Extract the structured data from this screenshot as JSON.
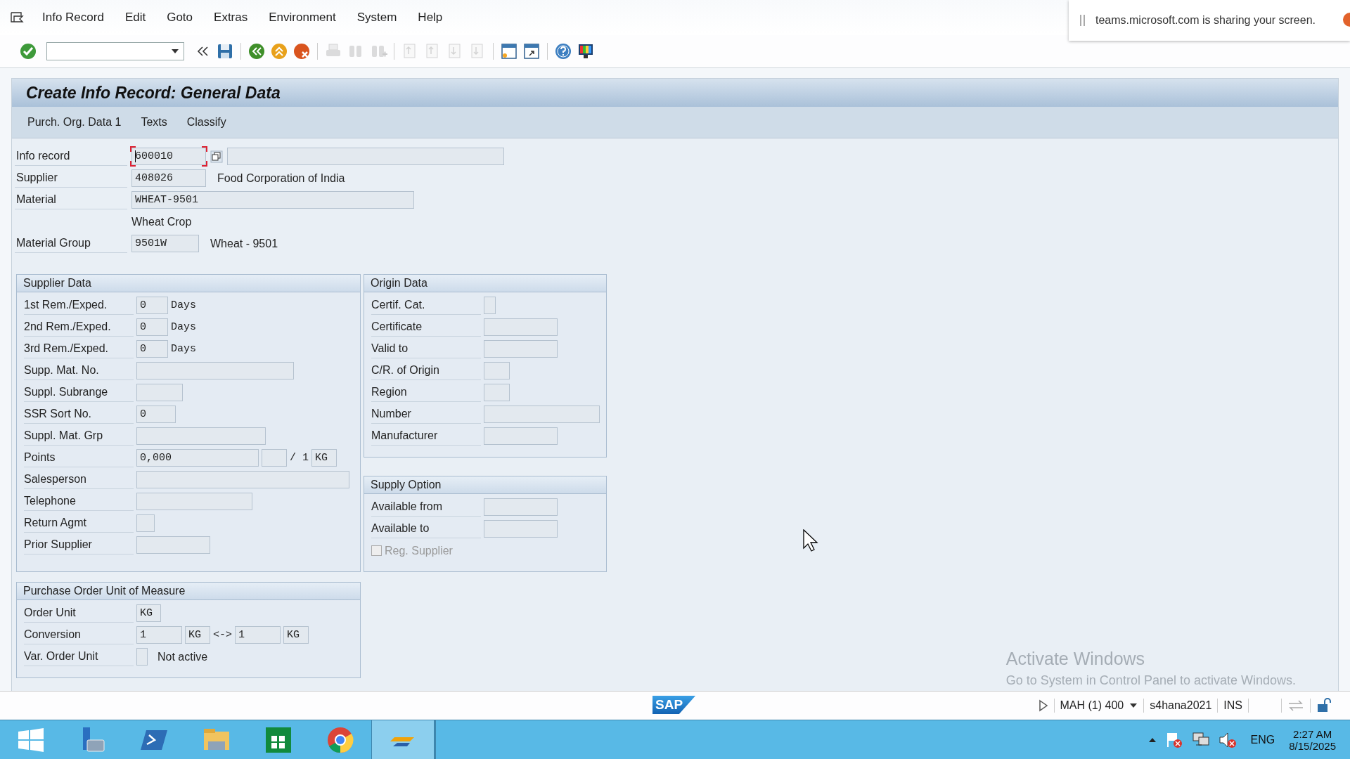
{
  "menu": [
    {
      "label": "Info Record"
    },
    {
      "label": "Edit"
    },
    {
      "label": "Goto"
    },
    {
      "label": "Extras"
    },
    {
      "label": "Environment"
    },
    {
      "label": "System"
    },
    {
      "label": "Help"
    }
  ],
  "toolbar": [
    {
      "kind": "enter",
      "disabled": false
    },
    {
      "kind": "command-field"
    },
    {
      "kind": "collapse",
      "disabled": false
    },
    {
      "kind": "save",
      "disabled": false
    },
    {
      "kind": "sep"
    },
    {
      "kind": "back",
      "disabled": false
    },
    {
      "kind": "exit",
      "disabled": false
    },
    {
      "kind": "cancel",
      "disabled": false
    },
    {
      "kind": "sep"
    },
    {
      "kind": "print",
      "disabled": true
    },
    {
      "kind": "find",
      "disabled": true
    },
    {
      "kind": "find-next",
      "disabled": true
    },
    {
      "kind": "sep"
    },
    {
      "kind": "first-page",
      "disabled": true
    },
    {
      "kind": "prev-page",
      "disabled": true
    },
    {
      "kind": "next-page",
      "disabled": true
    },
    {
      "kind": "last-page",
      "disabled": true
    },
    {
      "kind": "sep"
    },
    {
      "kind": "new-session",
      "disabled": false
    },
    {
      "kind": "shortcut",
      "disabled": false
    },
    {
      "kind": "sep"
    },
    {
      "kind": "help",
      "disabled": false
    },
    {
      "kind": "layout",
      "disabled": false
    }
  ],
  "notification": {
    "text": "teams.microsoft.com is sharing your screen."
  },
  "title": "Create Info Record: General Data",
  "app_toolbar": [
    {
      "label": "Purch. Org. Data 1"
    },
    {
      "label": "Texts"
    },
    {
      "label": "Classify"
    }
  ],
  "header": [
    {
      "label": "Info record",
      "parts": [
        {
          "kind": "field",
          "value": "600010",
          "focused": true
        },
        {
          "kind": "button"
        },
        {
          "kind": "field"
        }
      ]
    },
    {
      "label": "Supplier",
      "parts": [
        {
          "kind": "field",
          "value": "408026"
        },
        {
          "kind": "text",
          "value": "Food Corporation of India"
        }
      ]
    },
    {
      "label": "Material",
      "parts": [
        {
          "kind": "field",
          "value": "WHEAT-9501"
        }
      ]
    },
    {
      "parts": [
        {
          "kind": "text",
          "value": "Wheat Crop"
        }
      ]
    },
    {
      "label": "Material Group",
      "parts": [
        {
          "kind": "field",
          "value": "9501W"
        },
        {
          "kind": "text",
          "value": "Wheat - 9501"
        }
      ]
    }
  ],
  "groups": [
    {
      "title": "Supplier Data",
      "rows": [
        {
          "label": "1st Rem./Exped.",
          "parts": [
            {
              "kind": "field",
              "value": "0"
            },
            {
              "kind": "unit",
              "value": "Days"
            }
          ]
        },
        {
          "label": "2nd Rem./Exped.",
          "parts": [
            {
              "kind": "field",
              "value": "0"
            },
            {
              "kind": "unit",
              "value": "Days"
            }
          ]
        },
        {
          "label": "3rd Rem./Exped.",
          "parts": [
            {
              "kind": "field",
              "value": "0"
            },
            {
              "kind": "unit",
              "value": "Days"
            }
          ]
        },
        {
          "label": "Supp. Mat. No.",
          "parts": [
            {
              "kind": "field"
            }
          ]
        },
        {
          "label": "Suppl. Subrange",
          "parts": [
            {
              "kind": "field"
            }
          ]
        },
        {
          "label": "SSR Sort No.",
          "parts": [
            {
              "kind": "field",
              "value": "0"
            }
          ]
        },
        {
          "label": "Suppl. Mat. Grp",
          "parts": [
            {
              "kind": "field"
            }
          ]
        },
        {
          "label": "Points",
          "parts": [
            {
              "kind": "field",
              "value": "0,000"
            },
            {
              "kind": "field"
            },
            {
              "kind": "unit",
              "value": "/ 1"
            },
            {
              "kind": "field",
              "value": "KG"
            }
          ]
        },
        {
          "label": "Salesperson",
          "parts": [
            {
              "kind": "field"
            }
          ]
        },
        {
          "label": "Telephone",
          "parts": [
            {
              "kind": "field"
            }
          ]
        },
        {
          "label": "Return Agmt",
          "parts": [
            {
              "kind": "field"
            }
          ]
        },
        {
          "label": "Prior Supplier",
          "parts": [
            {
              "kind": "field"
            }
          ]
        }
      ]
    },
    {
      "title": "Origin Data",
      "rows": [
        {
          "label": "Certif. Cat.",
          "parts": [
            {
              "kind": "field"
            }
          ]
        },
        {
          "label": "Certificate",
          "parts": [
            {
              "kind": "field"
            }
          ]
        },
        {
          "label": "Valid to",
          "parts": [
            {
              "kind": "field"
            }
          ]
        },
        {
          "label": "C/R. of Origin",
          "parts": [
            {
              "kind": "field"
            }
          ]
        },
        {
          "label": "Region",
          "parts": [
            {
              "kind": "field"
            }
          ]
        },
        {
          "label": "Number",
          "parts": [
            {
              "kind": "field"
            }
          ]
        },
        {
          "label": "Manufacturer",
          "parts": [
            {
              "kind": "field"
            }
          ]
        }
      ]
    },
    {
      "title": "Supply Option",
      "rows": [
        {
          "label": "Available from",
          "parts": [
            {
              "kind": "field"
            }
          ]
        },
        {
          "label": "Available to",
          "parts": [
            {
              "kind": "field"
            }
          ]
        },
        {
          "parts": [
            {
              "kind": "checkbox",
              "value": "Reg. Supplier",
              "checked": false,
              "disabled": true
            }
          ]
        }
      ]
    },
    {
      "title": "Purchase Order Unit of Measure",
      "rows": [
        {
          "label": "Order Unit",
          "parts": [
            {
              "kind": "field",
              "value": "KG"
            }
          ]
        },
        {
          "label": "Conversion",
          "parts": [
            {
              "kind": "field",
              "value": "1"
            },
            {
              "kind": "field",
              "value": "KG"
            },
            {
              "kind": "unit",
              "value": "<->"
            },
            {
              "kind": "field",
              "value": "1"
            },
            {
              "kind": "field",
              "value": "KG"
            }
          ]
        },
        {
          "label": "Var. Order Unit",
          "parts": [
            {
              "kind": "field"
            },
            {
              "kind": "text",
              "value": "Not active"
            }
          ]
        }
      ]
    }
  ],
  "activation": {
    "title": "Activate Windows",
    "text": "Go to System in Control Panel to activate Windows."
  },
  "status_bar": {
    "logo": "SAP",
    "system": "MAH (1) 400",
    "server": "s4hana2021",
    "mode": "INS"
  },
  "taskbar": {
    "apps": [
      {
        "kind": "start",
        "selected": false
      },
      {
        "kind": "server-manager",
        "selected": false
      },
      {
        "kind": "powershell",
        "selected": false
      },
      {
        "kind": "explorer",
        "selected": false
      },
      {
        "kind": "store",
        "selected": false
      },
      {
        "kind": "chrome",
        "selected": false
      },
      {
        "kind": "sap",
        "selected": true
      }
    ],
    "language": "ENG",
    "time": "2:27 AM",
    "date": "8/15/2025"
  }
}
